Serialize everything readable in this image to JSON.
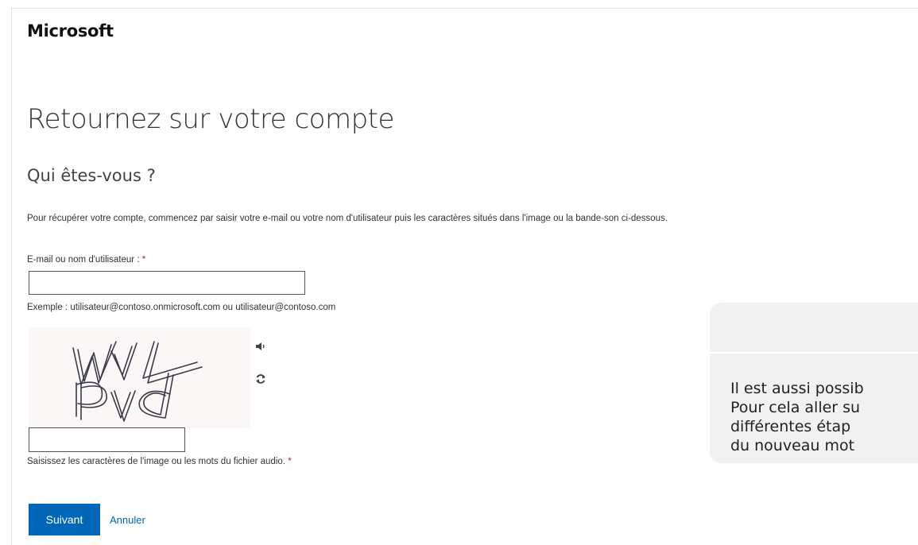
{
  "header": {
    "brand": "Microsoft"
  },
  "page": {
    "title": "Retournez sur votre compte",
    "section_title": "Qui êtes-vous ?",
    "instructions": "Pour récupérer votre compte, commencez par saisir votre e-mail ou votre nom d'utilisateur puis les caractères situés dans l'image ou la bande-son ci-dessous."
  },
  "form": {
    "email_label": "E-mail ou nom d'utilisateur :",
    "required_marker": "*",
    "email_value": "",
    "example": "Exemple : utilisateur@contoso.onmicrosoft.com ou utilisateur@contoso.com",
    "captcha_image_text": "WVL Pvd",
    "captcha_value": "",
    "captcha_hint": "Saisissez les caractères de l'image ou les mots du fichier audio.",
    "next_label": "Suivant",
    "cancel_label": "Annuler"
  },
  "icons": {
    "audio": "speaker-icon",
    "refresh": "refresh-icon"
  },
  "callout": {
    "lines": [
      "Il est aussi possib",
      "Pour cela aller su",
      "différentes étap",
      "du nouveau mot"
    ]
  },
  "colors": {
    "primary": "#0067b8",
    "required": "#cc1111",
    "callout_bg": "#f1f1f1"
  }
}
